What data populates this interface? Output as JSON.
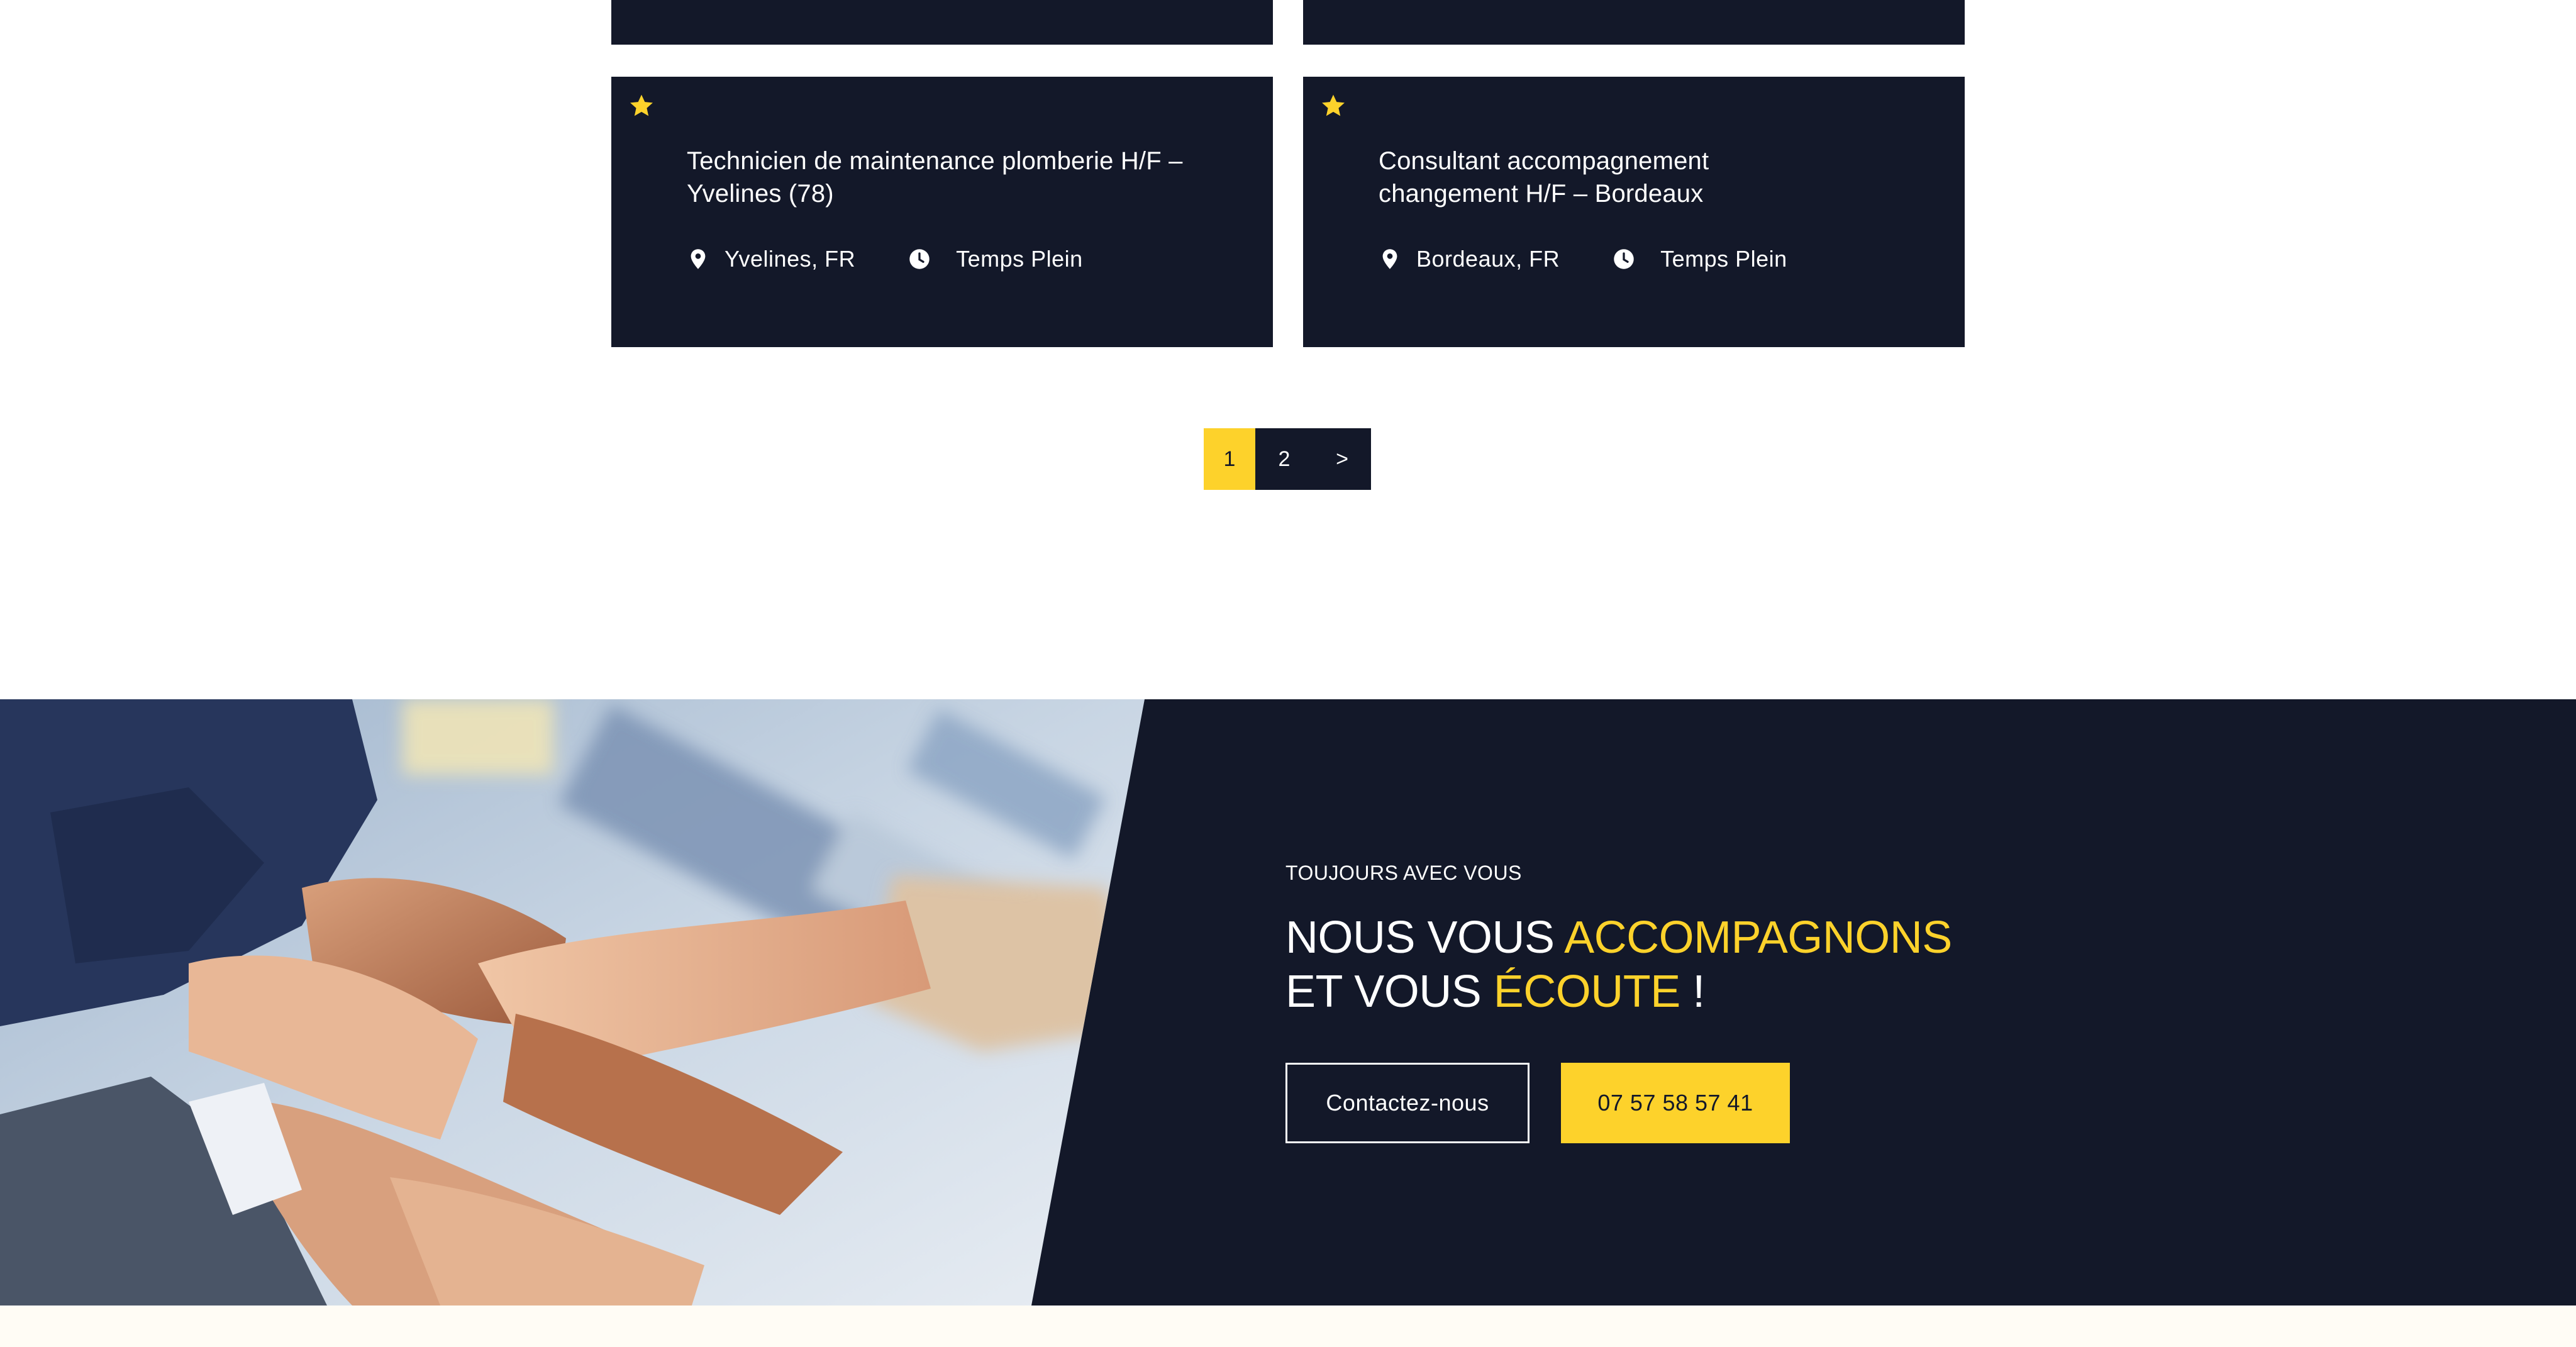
{
  "colors": {
    "navy": "#131829",
    "accent_yellow": "#fdd22b",
    "white": "#ffffff",
    "footer_cream": "#fffcf5"
  },
  "jobs": [
    {
      "title": "Technicien de maintenance plomberie H/F – Yvelines (78)",
      "location": "Yvelines, FR",
      "contract": "Temps Plein",
      "icons": [
        "star-icon",
        "map-pin-icon",
        "clock-icon"
      ]
    },
    {
      "title": "Consultant accompagnement changement H/F – Bordeaux",
      "location": "Bordeaux, FR",
      "contract": "Temps Plein",
      "icons": [
        "star-icon",
        "map-pin-icon",
        "clock-icon"
      ]
    }
  ],
  "pagination": {
    "current": "1",
    "page2": "2",
    "next": ">"
  },
  "cta": {
    "eyebrow": "TOUJOURS AVEC VOUS",
    "headline_1": "NOUS VOUS ",
    "headline_1_highlight": "ACCOMPAGNONS",
    "headline_2": "ET VOUS ",
    "headline_2_highlight": "ÉCOUTE",
    "headline_2_end": " !",
    "contact_label": "Contactez-nous",
    "phone_label": "07 57 58 57 41"
  }
}
